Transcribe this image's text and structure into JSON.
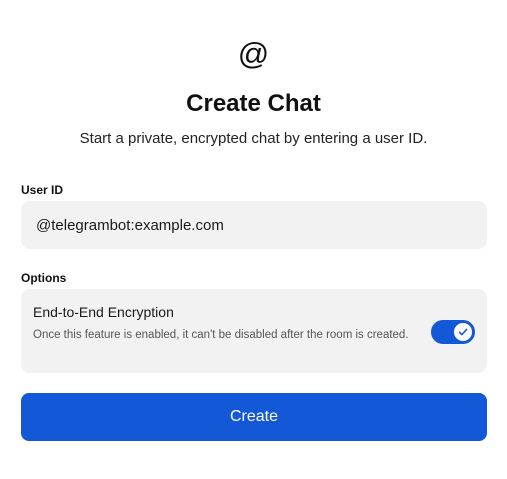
{
  "header": {
    "icon_glyph": "@",
    "icon_name": "at-sign-icon",
    "title": "Create Chat",
    "subtitle": "Start a private, encrypted chat by entering a user ID."
  },
  "user_id": {
    "label": "User ID",
    "value": "@telegrambot:example.com",
    "placeholder": ""
  },
  "options": {
    "label": "Options",
    "encryption": {
      "title": "End-to-End Encryption",
      "description": "Once this feature is enabled, it can't be disabled after the room is created.",
      "enabled": true
    }
  },
  "actions": {
    "create_label": "Create"
  },
  "colors": {
    "accent": "#1358d6",
    "field_background": "#f2f2f2"
  }
}
